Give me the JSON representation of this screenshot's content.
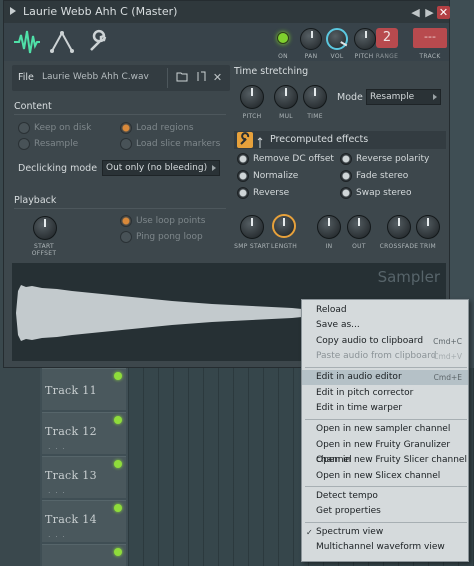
{
  "window": {
    "title": "Laurie Webb Ahh C (Master)"
  },
  "toolbar": {
    "knobs": [
      {
        "label": "ON"
      },
      {
        "label": "PAN"
      },
      {
        "label": "VOL"
      },
      {
        "label": "PITCH"
      },
      {
        "label": "RANGE"
      },
      {
        "label": "TRACK"
      }
    ],
    "range_value": "2",
    "track_value": "---"
  },
  "file": {
    "label": "File",
    "name": "Laurie Webb Ahh C.wav"
  },
  "content": {
    "title": "Content",
    "options": [
      "Keep on disk",
      "Resample",
      "Load regions",
      "Load slice markers"
    ],
    "declicking_label": "Declicking mode",
    "declicking_value": "Out only (no bleeding)"
  },
  "playback": {
    "title": "Playback",
    "knob_label": "START OFFSET",
    "options": [
      "Use loop points",
      "Ping pong loop"
    ]
  },
  "time_stretching": {
    "title": "Time stretching",
    "knobs": [
      "PITCH",
      "MUL",
      "TIME"
    ],
    "mode_label": "Mode",
    "mode_value": "Resample"
  },
  "precomputed": {
    "title": "Precomputed effects",
    "options": [
      "Remove DC offset",
      "Normalize",
      "Reverse",
      "Reverse polarity",
      "Fade stereo",
      "Swap stereo"
    ],
    "knobs": [
      "SMP START",
      "LENGTH",
      "IN",
      "OUT",
      "CROSSFADE",
      "TRIM"
    ]
  },
  "wave": {
    "label": "Sampler"
  },
  "playlist": {
    "tracks": [
      "Track 11",
      "Track 12",
      "Track 13",
      "Track 14"
    ]
  },
  "context_menu": {
    "items": [
      {
        "label": "Reload",
        "shortcut": "",
        "disabled": false
      },
      {
        "label": "Save as...",
        "shortcut": "",
        "disabled": false
      },
      {
        "label": "Copy audio to clipboard",
        "shortcut": "Cmd+C",
        "disabled": false
      },
      {
        "label": "Paste audio from clipboard",
        "shortcut": "Cmd+V",
        "disabled": true
      },
      {
        "label": "Edit in audio editor",
        "shortcut": "Cmd+E",
        "disabled": false
      },
      {
        "label": "Edit in pitch corrector",
        "shortcut": "",
        "disabled": false
      },
      {
        "label": "Edit in time warper",
        "shortcut": "",
        "disabled": false
      },
      {
        "label": "Open in new sampler channel",
        "shortcut": "",
        "disabled": false
      },
      {
        "label": "Open in new Fruity Granulizer channel",
        "shortcut": "",
        "disabled": false
      },
      {
        "label": "Open in new Fruity Slicer channel",
        "shortcut": "",
        "disabled": false
      },
      {
        "label": "Open in new Slicex channel",
        "shortcut": "",
        "disabled": false
      },
      {
        "label": "Detect tempo",
        "shortcut": "",
        "disabled": false
      },
      {
        "label": "Get properties",
        "shortcut": "",
        "disabled": false
      },
      {
        "label": "Spectrum view",
        "shortcut": "",
        "disabled": false
      },
      {
        "label": "Multichannel waveform view",
        "shortcut": "",
        "disabled": false
      }
    ]
  }
}
